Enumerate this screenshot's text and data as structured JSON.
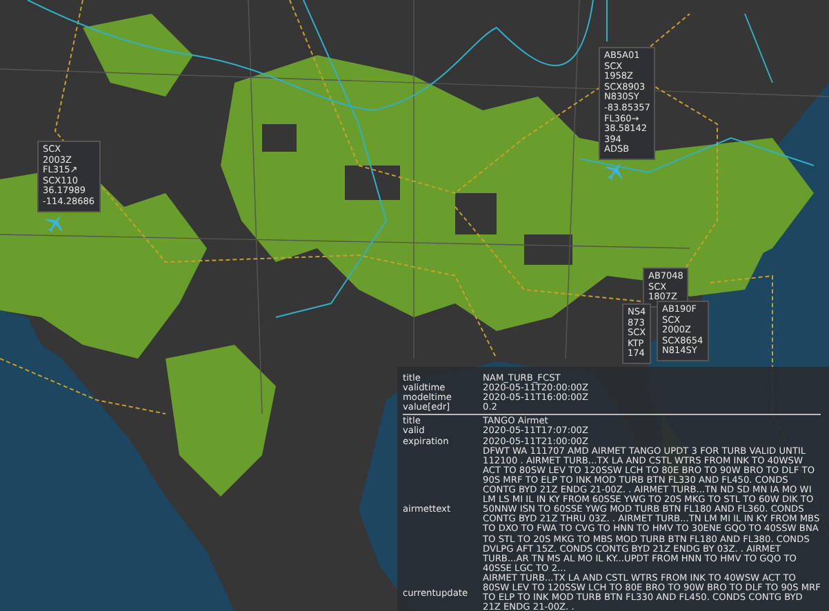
{
  "flight_labels": [
    {
      "lines": [
        "SCX",
        "2003Z",
        "FL315↗",
        "SCX110",
        "36.17989",
        "-114.28686"
      ]
    },
    {
      "lines": [
        "AB5A01",
        "SCX",
        "1958Z",
        "SCX8903",
        "N830SY",
        "-83.85357",
        "FL360→",
        "38.58142",
        "394",
        "ADSB"
      ]
    },
    {
      "lines": [
        "AB7048",
        "SCX",
        "1807Z"
      ]
    },
    {
      "lines": [
        "NS4",
        "873",
        "SCX",
        "KTP",
        "174"
      ]
    },
    {
      "lines": [
        "AB190F",
        "SCX",
        "2000Z",
        "SCX8654",
        "N814SY"
      ]
    }
  ],
  "info_popup": {
    "sections": [
      {
        "rows": [
          {
            "key": "title",
            "value": "NAM_TURB_FCST"
          },
          {
            "key": "validtime",
            "value": "2020-05-11T20:00:00Z"
          },
          {
            "key": "modeltime",
            "value": "2020-05-11T16:00:00Z"
          },
          {
            "key": "value[edr]",
            "value": "0.2"
          }
        ]
      },
      {
        "rows": [
          {
            "key": "title",
            "value": "TANGO Airmet"
          },
          {
            "key": "valid",
            "value": "2020-05-11T17:07:00Z"
          },
          {
            "key": "expiration",
            "value": "2020-05-11T21:00:00Z"
          },
          {
            "key": "airmettext",
            "value": "DFWT WA 111707 AMD AIRMET TANGO UPDT 3 FOR TURB VALID UNTIL 112100 . AIRMET TURB...TX LA AND CSTL WTRS FROM INK TO 40WSW ACT TO 80SW LEV TO 120SSW LCH TO 80E BRO TO 90W BRO TO DLF TO 90S MRF TO ELP TO INK MOD TURB BTN FL330 AND FL450. CONDS CONTG BYD 21Z ENDG 21-00Z. . AIRMET TURB...TN ND SD MN IA MO WI LM LS MI IL IN KY FROM 60SSE YWG TO 20S MKG TO STL TO 60W DIK TO 50NNW ISN TO 60SSE YWG MOD TURB BTN FL180 AND FL360. CONDS CONTG BYD 21Z THRU 03Z. . AIRMET TURB...TN LM MI IL IN KY FROM MBS TO DXO TO FWA TO CVG TO HNN TO HMV TO 30ENE GQO TO 40SSW BNA TO STL TO 20S MKG TO MBS MOD TURB BTN FL180 AND FL380. CONDS DVLPG AFT 15Z. CONDS CONTG BYD 21Z ENDG BY 03Z. . AIRMET TURB...AR TN MS AL MO IL KY...UPDT FROM HNN TO HMV TO GQO TO 40SSE LGC TO 2..."
          },
          {
            "key": "currentupdate",
            "value": "AIRMET TURB...TX LA AND CSTL WTRS FROM INK TO 40WSW ACT TO 80SW LEV TO 120SSW LCH TO 80E BRO TO 90W BRO TO DLF TO 90S MRF TO ELP TO INK MOD TURB BTN FL330 AND FL450. CONDS CONTG BYD 21Z ENDG 21-00Z. ."
          }
        ]
      }
    ]
  }
}
